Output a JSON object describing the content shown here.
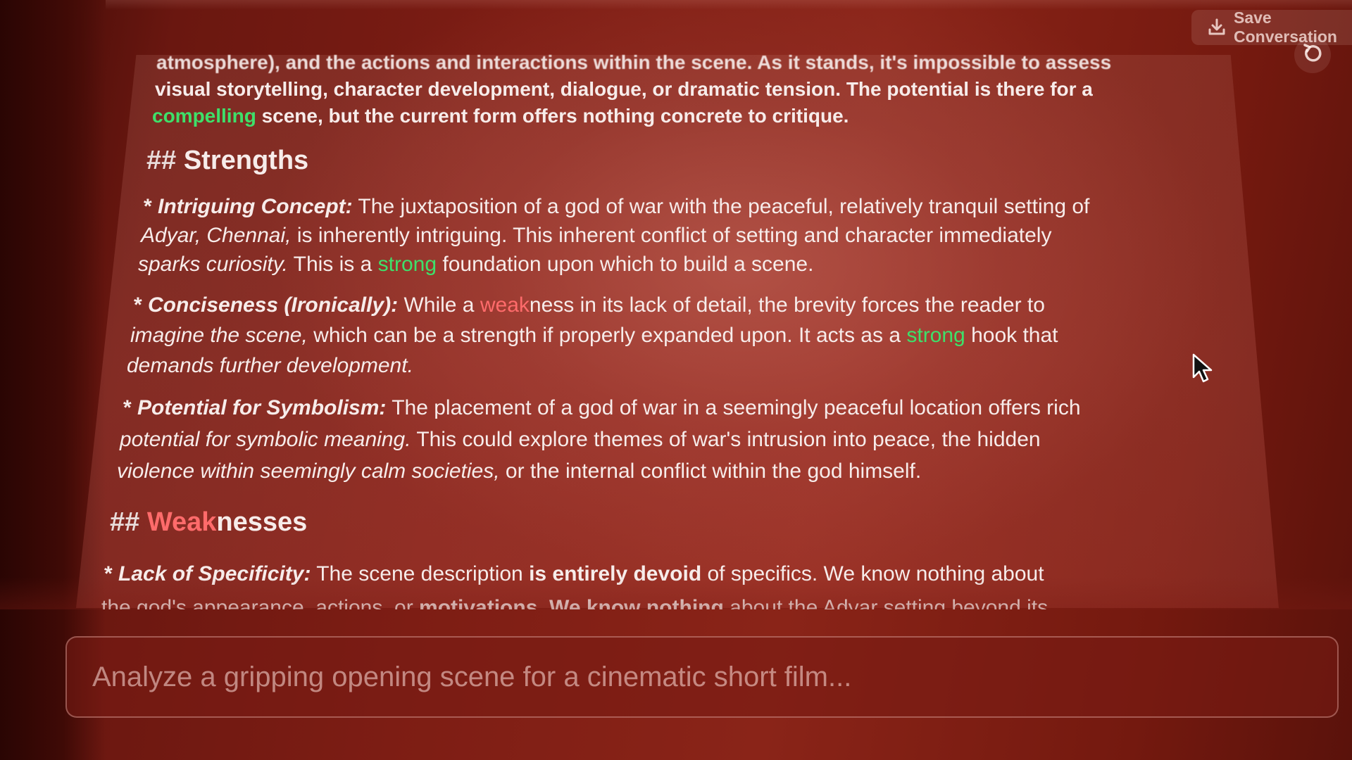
{
  "header": {
    "save_label": "Save Conversation",
    "save_icon": "download-icon",
    "refresh_icon": "refresh-icon"
  },
  "colors": {
    "positive_highlight": "#3ee06a",
    "negative_highlight": "#ff6b6b",
    "background": "#7d1d14"
  },
  "content": {
    "intro": {
      "line1": "atmosphere), and the actions and interactions within the scene.  As it stands, it's impossible to assess",
      "line2": "visual storytelling, character development, dialogue, or dramatic tension.  The potential is there for a",
      "line3_green": "compelling",
      "line3_rest": " scene, but the current form offers nothing concrete to critique."
    },
    "strengths": {
      "hash": "## ",
      "title": "Strengths",
      "items": [
        {
          "bullet": "* ",
          "label": "Intriguing Concept:",
          "l1": " The juxtaposition of a god of war with the peaceful, relatively tranquil setting of",
          "l2_italic": "Adyar, Chennai,",
          "l2_rest": " is inherently intriguing.  This inherent conflict of setting and character immediately",
          "l3_italic": "sparks curiosity.",
          "l3_a": "  This is a ",
          "l3_green": "strong",
          "l3_b": " foundation upon which to build a scene."
        },
        {
          "bullet": "* ",
          "label": "Conciseness (Ironically):",
          "l1_a": " While a ",
          "l1_red": "weak",
          "l1_b": "ness in its lack of detail, the brevity forces the reader to",
          "l2_italic": "imagine the scene,",
          "l2_a": " which can be a strength if properly expanded upon.  It acts as a ",
          "l2_green": "strong",
          "l2_b": " hook that",
          "l3_italic": "demands further development."
        },
        {
          "bullet": "* ",
          "label": "Potential for Symbolism:",
          "l1": " The placement of a god of war in a seemingly peaceful location offers rich",
          "l2_italic": "potential for symbolic meaning.",
          "l2_rest": "  This could explore themes of war's intrusion into peace, the hidden",
          "l3_italic": "violence within seemingly calm societies,",
          "l3_rest": " or the internal conflict within the god himself."
        }
      ]
    },
    "weaknesses": {
      "hash": "## ",
      "title_red": "Weak",
      "title_rest": "nesses",
      "items": [
        {
          "bullet": "* ",
          "label": "Lack of Specificity:",
          "l1_a": " The scene description ",
          "l1_bold": "is entirely devoid",
          "l1_b": " of specifics.  We know nothing about",
          "l2_a": "the god's appearance, actions, or ",
          "l2_bold": "motivations.  We know nothing",
          "l2_b": " about the Adyar setting beyond its"
        }
      ]
    }
  },
  "prompt": {
    "placeholder": "Analyze a gripping opening scene for a cinematic short film..."
  }
}
